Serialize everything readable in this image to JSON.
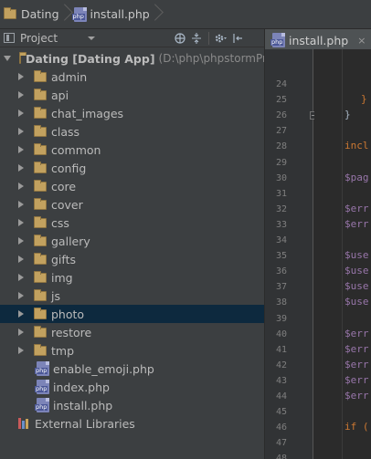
{
  "breadcrumb": {
    "items": [
      {
        "label": "Dating",
        "icon": "folder-icon"
      },
      {
        "label": "install.php",
        "icon": "php-file-icon"
      }
    ]
  },
  "project_panel": {
    "view_label": "Project",
    "toolbar_icons": [
      "sync-icon",
      "collapse-all-icon",
      "gear-icon",
      "hide-panel-icon"
    ]
  },
  "tree": {
    "root": {
      "label": "Dating [Dating App]",
      "path": "(D:\\php\\phpstormProjects"
    },
    "folders": [
      "admin",
      "api",
      "chat_images",
      "class",
      "common",
      "config",
      "core",
      "cover",
      "css",
      "gallery",
      "gifts",
      "img",
      "js",
      "photo",
      "restore",
      "tmp"
    ],
    "selected_folder": "photo",
    "files": [
      "enable_emoji.php",
      "index.php",
      "install.php"
    ],
    "external": "External Libraries"
  },
  "editor": {
    "tab_label": "install.php",
    "tab_close": "×",
    "line_numbers": [
      "24",
      "25",
      "26",
      "27",
      "28",
      "29",
      "30",
      "31",
      "32",
      "33",
      "34",
      "35",
      "36",
      "37",
      "38",
      "39",
      "40",
      "41",
      "42",
      "43",
      "44",
      "45",
      "46",
      "47",
      "48"
    ],
    "lines": {
      "25": {
        "text": "}",
        "color": "#cc7832",
        "indent": 18
      },
      "26": {
        "text": "}",
        "color": "#a9b7c6",
        "indent": 0
      },
      "28": {
        "text": "incl",
        "color": "#cc7832",
        "indent": 0
      },
      "30": {
        "text": "$pag",
        "color": "#9876aa",
        "indent": 0
      },
      "32": {
        "text": "$err",
        "color": "#9876aa",
        "indent": 0
      },
      "33": {
        "text": "$err",
        "color": "#9876aa",
        "indent": 0
      },
      "35": {
        "text": "$use",
        "color": "#9876aa",
        "indent": 0
      },
      "36": {
        "text": "$use",
        "color": "#9876aa",
        "indent": 0
      },
      "37": {
        "text": "$use",
        "color": "#9876aa",
        "indent": 0
      },
      "38": {
        "text": "$use",
        "color": "#9876aa",
        "indent": 0
      },
      "40": {
        "text": "$err",
        "color": "#9876aa",
        "indent": 0
      },
      "41": {
        "text": "$err",
        "color": "#9876aa",
        "indent": 0
      },
      "42": {
        "text": "$err",
        "color": "#9876aa",
        "indent": 0
      },
      "43": {
        "text": "$err",
        "color": "#9876aa",
        "indent": 0
      },
      "44": {
        "text": "$err",
        "color": "#9876aa",
        "indent": 0
      },
      "46": {
        "text": "if (",
        "color": "#cc7832",
        "indent": 0
      }
    }
  },
  "colors": {
    "panel_bg": "#3c3f41",
    "editor_bg": "#2b2b2b",
    "selection_bg": "#0d293e",
    "folder": "#c2a15f",
    "keyword": "#cc7832",
    "variable": "#9876aa"
  }
}
